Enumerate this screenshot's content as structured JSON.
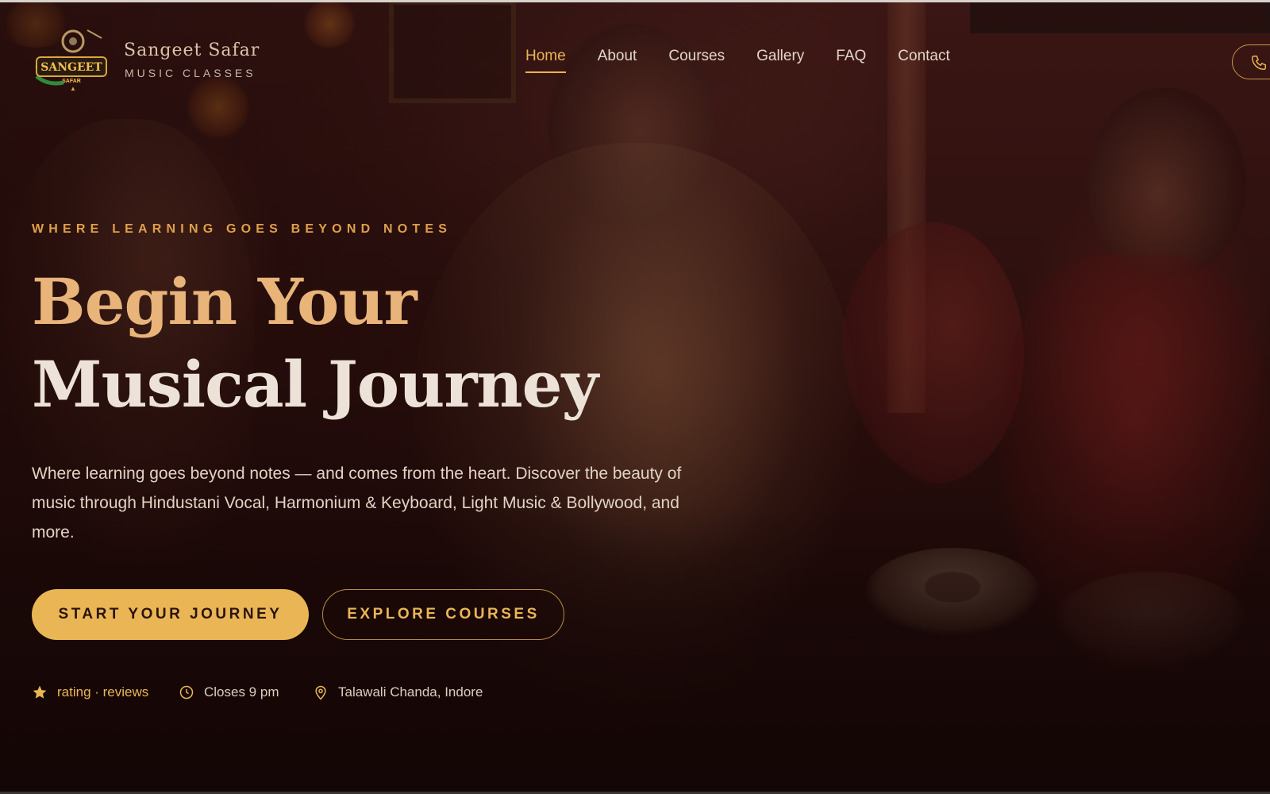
{
  "brand": {
    "name": "Sangeet Safar",
    "tagline": "MUSIC CLASSES",
    "logo_text": "SANGEET",
    "logo_subtext": "SAFAR"
  },
  "nav": {
    "items": [
      {
        "label": "Home",
        "active": true
      },
      {
        "label": "About",
        "active": false
      },
      {
        "label": "Courses",
        "active": false
      },
      {
        "label": "Gallery",
        "active": false
      },
      {
        "label": "FAQ",
        "active": false
      },
      {
        "label": "Contact",
        "active": false
      }
    ],
    "phone_icon": "phone-icon"
  },
  "hero": {
    "eyebrow": "WHERE LEARNING GOES BEYOND NOTES",
    "title_line1": "Begin Your",
    "title_line2": "Musical Journey",
    "description": "Where learning goes beyond notes — and comes from the heart. Discover the beauty of music through Hindustani Vocal, Harmonium & Keyboard, Light Music & Bollywood, and more.",
    "primary_cta": "START YOUR JOURNEY",
    "secondary_cta": "EXPLORE COURSES"
  },
  "info": {
    "rating": "rating · reviews",
    "hours": "Closes 9 pm",
    "location": "Talawali Chanda, Indore"
  },
  "colors": {
    "accent": "#eab655",
    "background": "#2b0f0d",
    "title_gold": "#e9b47a"
  }
}
